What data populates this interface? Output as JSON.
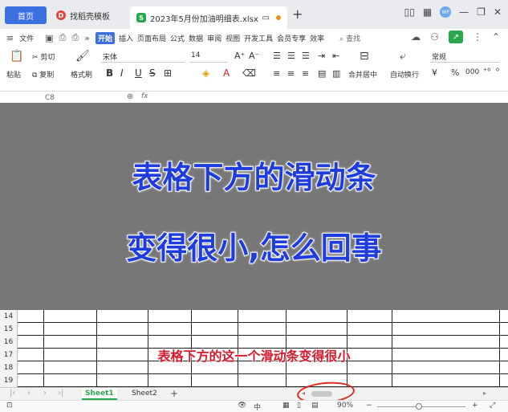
{
  "tabs": {
    "home": "首页",
    "template": "找稻壳模板",
    "file": "2023年5月份加油明细表.xlsx",
    "template_badge": "D",
    "file_badge": "S",
    "new_tab": "+"
  },
  "window": {
    "avatar": "WP"
  },
  "menu": {
    "file": "文件",
    "items": [
      "开始",
      "插入",
      "页面布局",
      "公式",
      "数据",
      "审阅",
      "视图",
      "开发工具",
      "会员专享",
      "效率"
    ],
    "search": "查找"
  },
  "ribbon": {
    "paste": "粘贴",
    "cut": "剪切",
    "copy": "复制",
    "format_painter": "格式刷",
    "font_name": "宋体",
    "font_size": "14",
    "merge_center": "合并居中",
    "wrap_text": "自动换行",
    "number_format": "常规",
    "bold": "B",
    "italic": "I",
    "underline": "U",
    "currency": "¥",
    "percent": "%",
    "thousands": "000"
  },
  "formula": {
    "name_box": "C8",
    "fx": "fx"
  },
  "overlay": {
    "line1": "表格下方的滑动条",
    "line2": "变得很小,怎么回事"
  },
  "grid": {
    "rows": [
      "14",
      "15",
      "16",
      "17",
      "18",
      "19"
    ],
    "caption": "表格下方的这一个滑动条变得很小"
  },
  "sheets": {
    "sheet1": "Sheet1",
    "sheet2": "Sheet2",
    "add": "+"
  },
  "status": {
    "zoom": "90%"
  },
  "colors": {
    "accent": "#3c6fe0",
    "overlay_text": "#1f3dde",
    "caption": "#d7192b",
    "ring": "#e0271c",
    "sheet_active": "#2aa64d"
  }
}
